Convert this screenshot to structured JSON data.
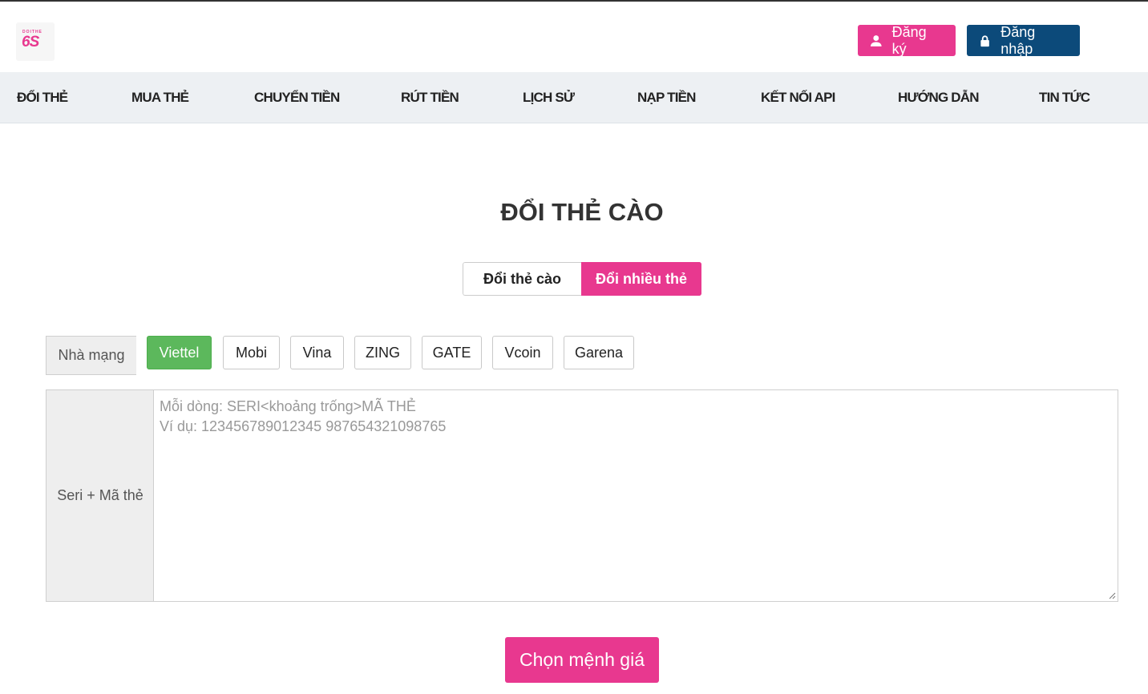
{
  "header": {
    "logo": {
      "sub": "DOITHE",
      "main": "6S"
    },
    "register_label": "Đăng ký",
    "login_label": "Đăng nhập"
  },
  "nav": {
    "items": [
      "ĐỔI THẺ",
      "MUA THẺ",
      "CHUYỂN TIỀN",
      "RÚT TIỀN",
      "LỊCH SỬ",
      "NẠP TIỀN",
      "KẾT NỐI API",
      "HƯỚNG DẪN",
      "TIN TỨC"
    ]
  },
  "main": {
    "title": "ĐỔI THẺ CÀO",
    "tabs": [
      {
        "label": "Đổi thẻ cào",
        "active": false
      },
      {
        "label": "Đổi nhiều thẻ",
        "active": true
      }
    ],
    "network_label": "Nhà mạng",
    "networks": [
      {
        "label": "Viettel",
        "active": true
      },
      {
        "label": "Mobi",
        "active": false
      },
      {
        "label": "Vina",
        "active": false
      },
      {
        "label": "ZING",
        "active": false
      },
      {
        "label": "GATE",
        "active": false
      },
      {
        "label": "Vcoin",
        "active": false
      },
      {
        "label": "Garena",
        "active": false
      }
    ],
    "codes_label": "Seri + Mã thẻ",
    "codes_placeholder_line1": "Mỗi dòng: SERI<khoảng trống>MÃ THẺ",
    "codes_placeholder_line2": "Ví dụ: 123456789012345 987654321098765",
    "codes_value": "",
    "submit_label": "Chọn mệnh giá"
  },
  "colors": {
    "brand_pink": "#e8388f",
    "login_blue": "#0c4a7a",
    "active_green": "#5cb85c",
    "nav_bg": "#edf0f3"
  },
  "icons": {
    "register": "user-icon",
    "login": "lock-icon",
    "resize": "resize-handle-icon"
  }
}
